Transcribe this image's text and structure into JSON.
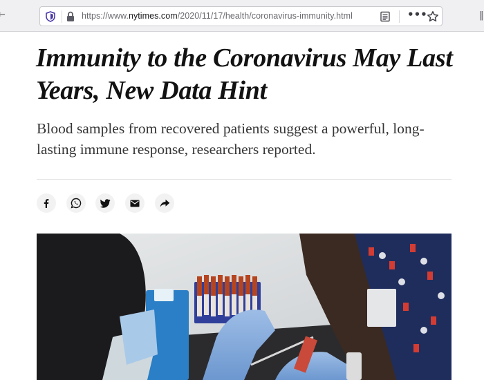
{
  "browser": {
    "url_prefix": "https://www.",
    "url_domain": "nytimes.com",
    "url_path": "/2020/11/17/health/coronavirus-immunity.html",
    "icons": [
      "back-arrow-icon",
      "tracking-shield-icon",
      "lock-icon",
      "reader-view-icon",
      "page-actions-icon",
      "bookmark-star-icon",
      "extensions-icon"
    ]
  },
  "article": {
    "headline": "Immunity to the Coronavirus May Last Years, New Data Hint",
    "summary": "Blood samples from recovered patients suggest a powerful, long-lasting immune response, researchers reported."
  },
  "share": {
    "buttons": [
      "facebook-icon",
      "whatsapp-icon",
      "twitter-icon",
      "email-icon",
      "share-arrow-icon"
    ]
  },
  "colors": {
    "headline": "#121212",
    "summary": "#363636",
    "share_bg": "#f2f2f2",
    "glove_blue": "#7fa8d8",
    "scrubs_navy": "#1f2d5c"
  }
}
